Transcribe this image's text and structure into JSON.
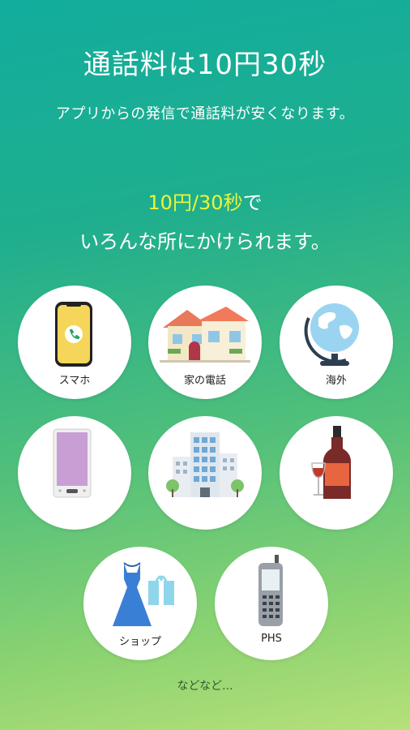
{
  "header": {
    "title": "通話料は10円30秒",
    "subtitle": "アプリからの発信で通話料が安くなります。"
  },
  "promo": {
    "highlight": "10円/30秒",
    "highlight_suffix": "で",
    "line2": "いろんな所にかけられます。"
  },
  "destinations": [
    {
      "label": "スマホ",
      "icon": "smartphone-icon"
    },
    {
      "label": "家の電話",
      "icon": "house-icon"
    },
    {
      "label": "海外",
      "icon": "globe-icon"
    },
    {
      "label": "",
      "icon": "feature-phone-icon"
    },
    {
      "label": "",
      "icon": "office-building-icon"
    },
    {
      "label": "",
      "icon": "wine-bottle-icon"
    },
    {
      "label": "ショップ",
      "icon": "dress-gift-icon"
    },
    {
      "label": "PHS",
      "icon": "phs-phone-icon"
    }
  ],
  "footer": {
    "text": "などなど..."
  },
  "colors": {
    "highlight": "#e9f53c",
    "gradient_top": "#12ad9d",
    "gradient_bottom": "#b6e07a"
  }
}
